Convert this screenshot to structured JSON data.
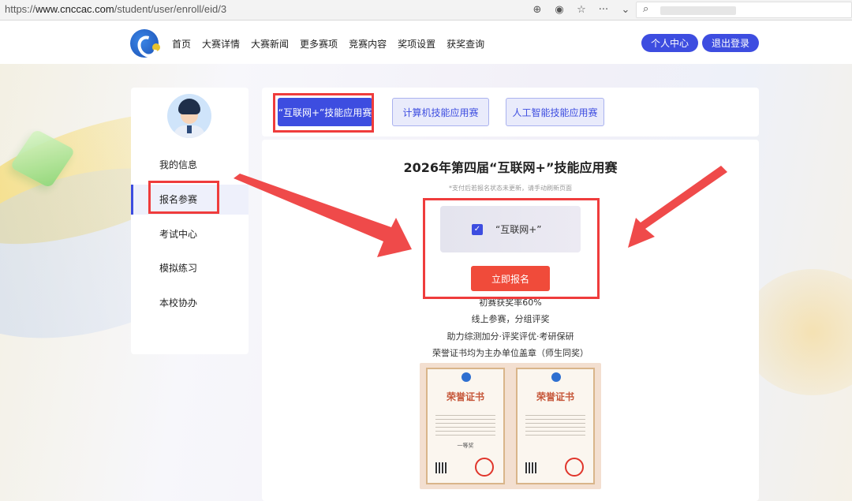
{
  "browser": {
    "url_prefix": "https://",
    "url_host": "www.cnccac.com",
    "url_path": "/student/user/enroll/eid/3"
  },
  "nav": {
    "links": [
      "首页",
      "大赛详情",
      "大赛新闻",
      "更多赛项",
      "竞赛内容",
      "奖项设置",
      "获奖查询"
    ],
    "personal_center": "个人中心",
    "logout": "退出登录"
  },
  "sidebar": {
    "items": [
      "我的信息",
      "报名参赛",
      "考试中心",
      "模拟练习",
      "本校协办"
    ],
    "active_index": 1
  },
  "tabs": [
    {
      "label": "“互联网+”技能应用赛",
      "active": true
    },
    {
      "label": "计算机技能应用赛",
      "active": false
    },
    {
      "label": "人工智能技能应用赛",
      "active": false
    }
  ],
  "main": {
    "title": "2026年第四届“互联网+”技能应用赛",
    "note": "*支付后若报名状态未更新，请手动刷新页面",
    "option_label": "“互联网+”",
    "option_checked": true,
    "submit_label": "立即报名",
    "info_lines": [
      "初赛获奖率60%",
      "线上参赛，分组评奖",
      "助力综测加分·评奖评优·考研保研",
      "荣誉证书均为主办单位盖章（师生同奖）"
    ],
    "cert_title": "荣誉证书",
    "cert_rank": "一等奖"
  },
  "colors": {
    "accent": "#3d4de0",
    "submit": "#f04b3a",
    "annotation": "#ef3c3c"
  },
  "icons": [
    "zoom-icon",
    "location-icon",
    "star-icon",
    "more-icon",
    "chevron-down-icon",
    "search-icon",
    "checkbox-icon"
  ]
}
